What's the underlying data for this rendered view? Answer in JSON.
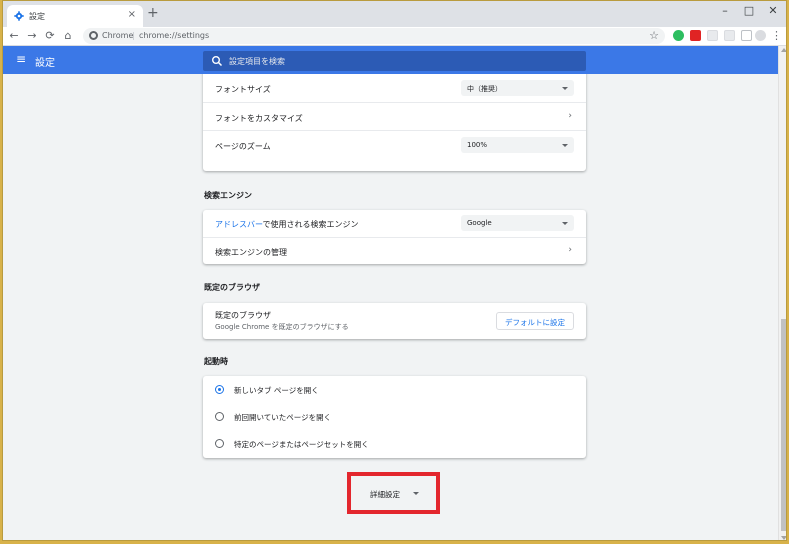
{
  "tab": {
    "title": "設定",
    "favicon": "gear-icon",
    "close": "×"
  },
  "new_tab": "+",
  "window": {
    "minimize": "–",
    "maximize": "□",
    "close": "✕"
  },
  "toolbar": {
    "back": "←",
    "forward": "→",
    "reload": "⟳",
    "home": "⌂",
    "site_label": "Chrome",
    "separator": "|",
    "url": "chrome://settings",
    "bookmark_star": "☆",
    "extensions": [
      {
        "name": "evernote-icon",
        "color": "#2dbe60"
      },
      {
        "name": "flag-extension-icon",
        "color": "#e02424"
      },
      {
        "name": "extension-icon",
        "color": "#dadce0"
      },
      {
        "name": "extension-icon-2",
        "color": "#dadce0"
      },
      {
        "name": "cursor-extension-icon",
        "color": "#bdc1c6"
      }
    ],
    "menu": "⋮"
  },
  "header": {
    "title": "設定",
    "menu_icon": "≡",
    "search_placeholder": "設定項目を検索"
  },
  "colors": {
    "accent": "#3b78e7",
    "link": "#1a73e8",
    "highlight": "#e3262d"
  },
  "appearance_card": {
    "font_size_label": "フォントサイズ",
    "font_size_value": "中（推奨）",
    "customize_fonts_label": "フォントをカスタマイズ",
    "page_zoom_label": "ページのズーム",
    "page_zoom_value": "100%"
  },
  "search_engine": {
    "section_title": "検索エンジン",
    "address_bar_link": "アドレスバー",
    "address_bar_label": "で使用される検索エンジン",
    "engine_value": "Google",
    "manage_label": "検索エンジンの管理"
  },
  "default_browser": {
    "section_title": "既定のブラウザ",
    "row_title": "既定のブラウザ",
    "row_subtitle": "Google Chrome を既定のブラウザにする",
    "button_label": "デフォルトに設定"
  },
  "on_startup": {
    "section_title": "起動時",
    "options": [
      {
        "label": "新しいタブ ページを開く",
        "selected": true
      },
      {
        "label": "前回開いていたページを開く",
        "selected": false
      },
      {
        "label": "特定のページまたはページセットを開く",
        "selected": false
      }
    ]
  },
  "advanced": {
    "label": "詳細設定"
  }
}
